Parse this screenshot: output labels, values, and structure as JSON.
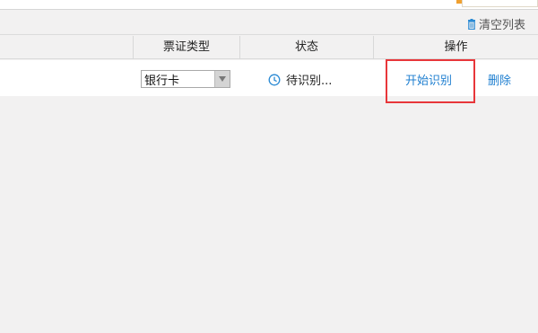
{
  "toolbar": {
    "clear_label": "清空列表",
    "clear_icon": "trash-icon"
  },
  "table": {
    "headers": [
      "票证类型",
      "状态",
      "操作"
    ],
    "rows": [
      {
        "ticket_type": "银行卡",
        "status": "待识别...",
        "status_icon": "clock-icon",
        "actions": [
          "开始识别",
          "删除"
        ]
      }
    ]
  },
  "colors": {
    "link": "#1f7fd0",
    "highlight": "#e8363a",
    "accent": "#f0a030"
  }
}
